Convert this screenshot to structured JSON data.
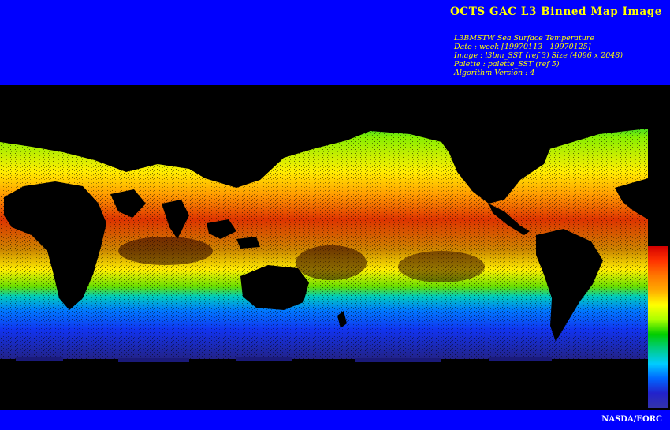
{
  "header": {
    "title": "OCTS GAC L3 Binned Map Image",
    "meta_lines": [
      "L3BMSTW Sea Surface Temperature",
      "Date : week [19970113 - 19970125]",
      "Image : l3bm_SST (ref 3) Size (4096 x 2048)",
      "Palette : palette_SST (ref 5)",
      "Algorithm Version : 4"
    ]
  },
  "map": {
    "colors": {
      "background": "#000000",
      "warmest": "#d40000",
      "warm": "#ff8800",
      "moderate": "#ffff00",
      "mild": "#00cc00",
      "cool": "#00ccff",
      "cold": "#0033ff",
      "coldest": "#2222aa"
    }
  },
  "colorbar": {
    "stops": [
      "#d40000",
      "#ff3300",
      "#ff7700",
      "#ffaa00",
      "#ffff00",
      "#aaff00",
      "#00cc00",
      "#00cc88",
      "#00ccff",
      "#0066ff",
      "#2222cc",
      "#3333aa"
    ]
  },
  "footer": {
    "credit": "NASDA/EORC"
  },
  "theme": {
    "frame_blue": "#0000ff",
    "title_yellow": "#ffff00"
  }
}
